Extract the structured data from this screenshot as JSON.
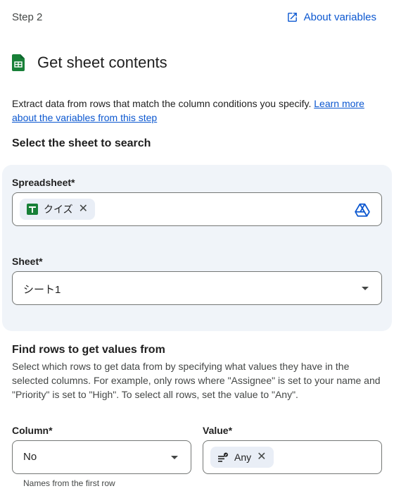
{
  "header": {
    "step_label": "Step 2",
    "about_link": "About variables"
  },
  "title": "Get sheet contents",
  "description": {
    "text": "Extract data from rows that match the column conditions you specify. ",
    "link": "Learn more about the variables from this step"
  },
  "sheet_section": {
    "heading": "Select the sheet to search",
    "spreadsheet_label": "Spreadsheet*",
    "spreadsheet_chip": "クイズ",
    "sheet_label": "Sheet*",
    "sheet_value": "シート1"
  },
  "rows_section": {
    "heading": "Find rows to get values from",
    "description": "Select which rows to get data from by specifying what values they have in the selected columns. For example, only rows where \"Assignee\" is set to your name and \"Priority\" is set to \"High\". To select all rows, set the value to \"Any\".",
    "column_label": "Column*",
    "column_value": "No",
    "column_helper": "Names from the first row",
    "value_label": "Value*",
    "value_chip": "Any"
  },
  "colors": {
    "accent": "#0b57d0",
    "panel_bg": "#f0f4f9",
    "sheets_green": "#188038"
  },
  "icons": {
    "about": "open-in-new-icon",
    "sheets": "google-sheets-icon",
    "drive": "google-drive-icon",
    "any": "variable-icon"
  }
}
